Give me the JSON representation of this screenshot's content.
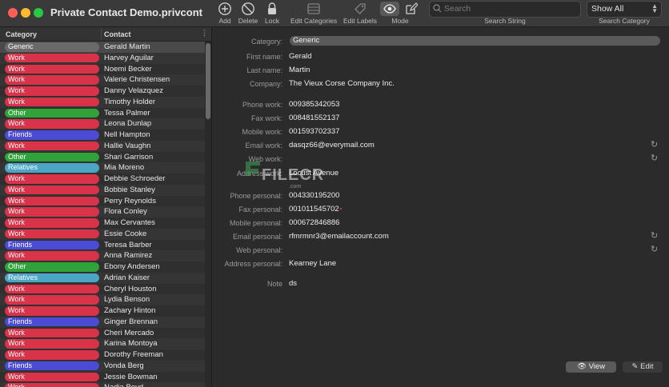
{
  "window": {
    "title": "Private Contact Demo.privcont"
  },
  "toolbar": {
    "add": "Add",
    "delete": "Delete",
    "lock": "Lock",
    "edit_categories": "Edit Categories",
    "edit_labels": "Edit Labels",
    "mode": "Mode",
    "search_placeholder": "Search",
    "search_label": "Search String",
    "category_value": "Show All",
    "category_label": "Search Category"
  },
  "list": {
    "col_category": "Category",
    "col_contact": "Contact",
    "rows": [
      {
        "category": "Generic",
        "name": "Gerald Martin",
        "color": "#6a6a6a"
      },
      {
        "category": "Work",
        "name": "Harvey Aguilar",
        "color": "#d9334a"
      },
      {
        "category": "Work",
        "name": "Noemi Becker",
        "color": "#d9334a"
      },
      {
        "category": "Work",
        "name": "Valerie Christensen",
        "color": "#d9334a"
      },
      {
        "category": "Work",
        "name": "Danny Velazquez",
        "color": "#d9334a"
      },
      {
        "category": "Work",
        "name": "Timothy Holder",
        "color": "#d9334a"
      },
      {
        "category": "Other",
        "name": "Tessa Palmer",
        "color": "#2fa33a"
      },
      {
        "category": "Work",
        "name": "Leona Dunlap",
        "color": "#d9334a"
      },
      {
        "category": "Friends",
        "name": "Nell Hampton",
        "color": "#4b4bd6"
      },
      {
        "category": "Work",
        "name": "Hallie Vaughn",
        "color": "#d9334a"
      },
      {
        "category": "Other",
        "name": "Shari Garrison",
        "color": "#2fa33a"
      },
      {
        "category": "Relatives",
        "name": "Mia Moreno",
        "color": "#4ba6c6"
      },
      {
        "category": "Work",
        "name": "Debbie Schroeder",
        "color": "#d9334a"
      },
      {
        "category": "Work",
        "name": "Bobbie Stanley",
        "color": "#d9334a"
      },
      {
        "category": "Work",
        "name": "Perry Reynolds",
        "color": "#d9334a"
      },
      {
        "category": "Work",
        "name": "Flora Conley",
        "color": "#d9334a"
      },
      {
        "category": "Work",
        "name": "Max Cervantes",
        "color": "#d9334a"
      },
      {
        "category": "Work",
        "name": "Essie Cooke",
        "color": "#d9334a"
      },
      {
        "category": "Friends",
        "name": "Teresa Barber",
        "color": "#4b4bd6"
      },
      {
        "category": "Work",
        "name": "Anna Ramirez",
        "color": "#d9334a"
      },
      {
        "category": "Other",
        "name": "Ebony Andersen",
        "color": "#2fa33a"
      },
      {
        "category": "Relatives",
        "name": "Adrian Kaiser",
        "color": "#4ba6c6"
      },
      {
        "category": "Work",
        "name": "Cheryl Houston",
        "color": "#d9334a"
      },
      {
        "category": "Work",
        "name": "Lydia Benson",
        "color": "#d9334a"
      },
      {
        "category": "Work",
        "name": "Zachary Hinton",
        "color": "#d9334a"
      },
      {
        "category": "Friends",
        "name": "Ginger Brennan",
        "color": "#4b4bd6"
      },
      {
        "category": "Work",
        "name": "Cheri Mercado",
        "color": "#d9334a"
      },
      {
        "category": "Work",
        "name": "Karina Montoya",
        "color": "#d9334a"
      },
      {
        "category": "Work",
        "name": "Dorothy Freeman",
        "color": "#d9334a"
      },
      {
        "category": "Friends",
        "name": "Vonda Berg",
        "color": "#4b4bd6"
      },
      {
        "category": "Work",
        "name": "Jessie Bowman",
        "color": "#d9334a"
      },
      {
        "category": "Work",
        "name": "Nadia Boyd",
        "color": "#d9334a"
      }
    ]
  },
  "detail": {
    "category_label": "Category:",
    "category_value": "Generic",
    "first_name_label": "First name:",
    "first_name": "Gerald",
    "last_name_label": "Last name:",
    "last_name": "Martin",
    "company_label": "Company:",
    "company": "The Vieux Corse Company Inc.",
    "phone_work_label": "Phone work:",
    "phone_work": "009385342053",
    "fax_work_label": "Fax work:",
    "fax_work": "008481552137",
    "mobile_work_label": "Mobile work:",
    "mobile_work": "001593702337",
    "email_work_label": "Email work:",
    "email_work": "dasqz66@everymail.com",
    "web_work_label": "Web work:",
    "web_work": "",
    "address_work_label": "Address work:",
    "address_work": "Locust Avenue",
    "phone_personal_label": "Phone personal:",
    "phone_personal": "004330195200",
    "fax_personal_label": "Fax personal:",
    "fax_personal": "001011545702",
    "mobile_personal_label": "Mobile personal:",
    "mobile_personal": "000672846886",
    "email_personal_label": "Email personal:",
    "email_personal": "rfmrmnr3@emailaccount.com",
    "web_personal_label": "Web personal:",
    "web_personal": "",
    "address_personal_label": "Address personal:",
    "address_personal": "Kearney Lane",
    "note_label": "Note",
    "note": "ds",
    "view_button": "View",
    "edit_button": "Edit"
  },
  "watermark": {
    "text": "FILECR",
    "sub": ".com"
  }
}
